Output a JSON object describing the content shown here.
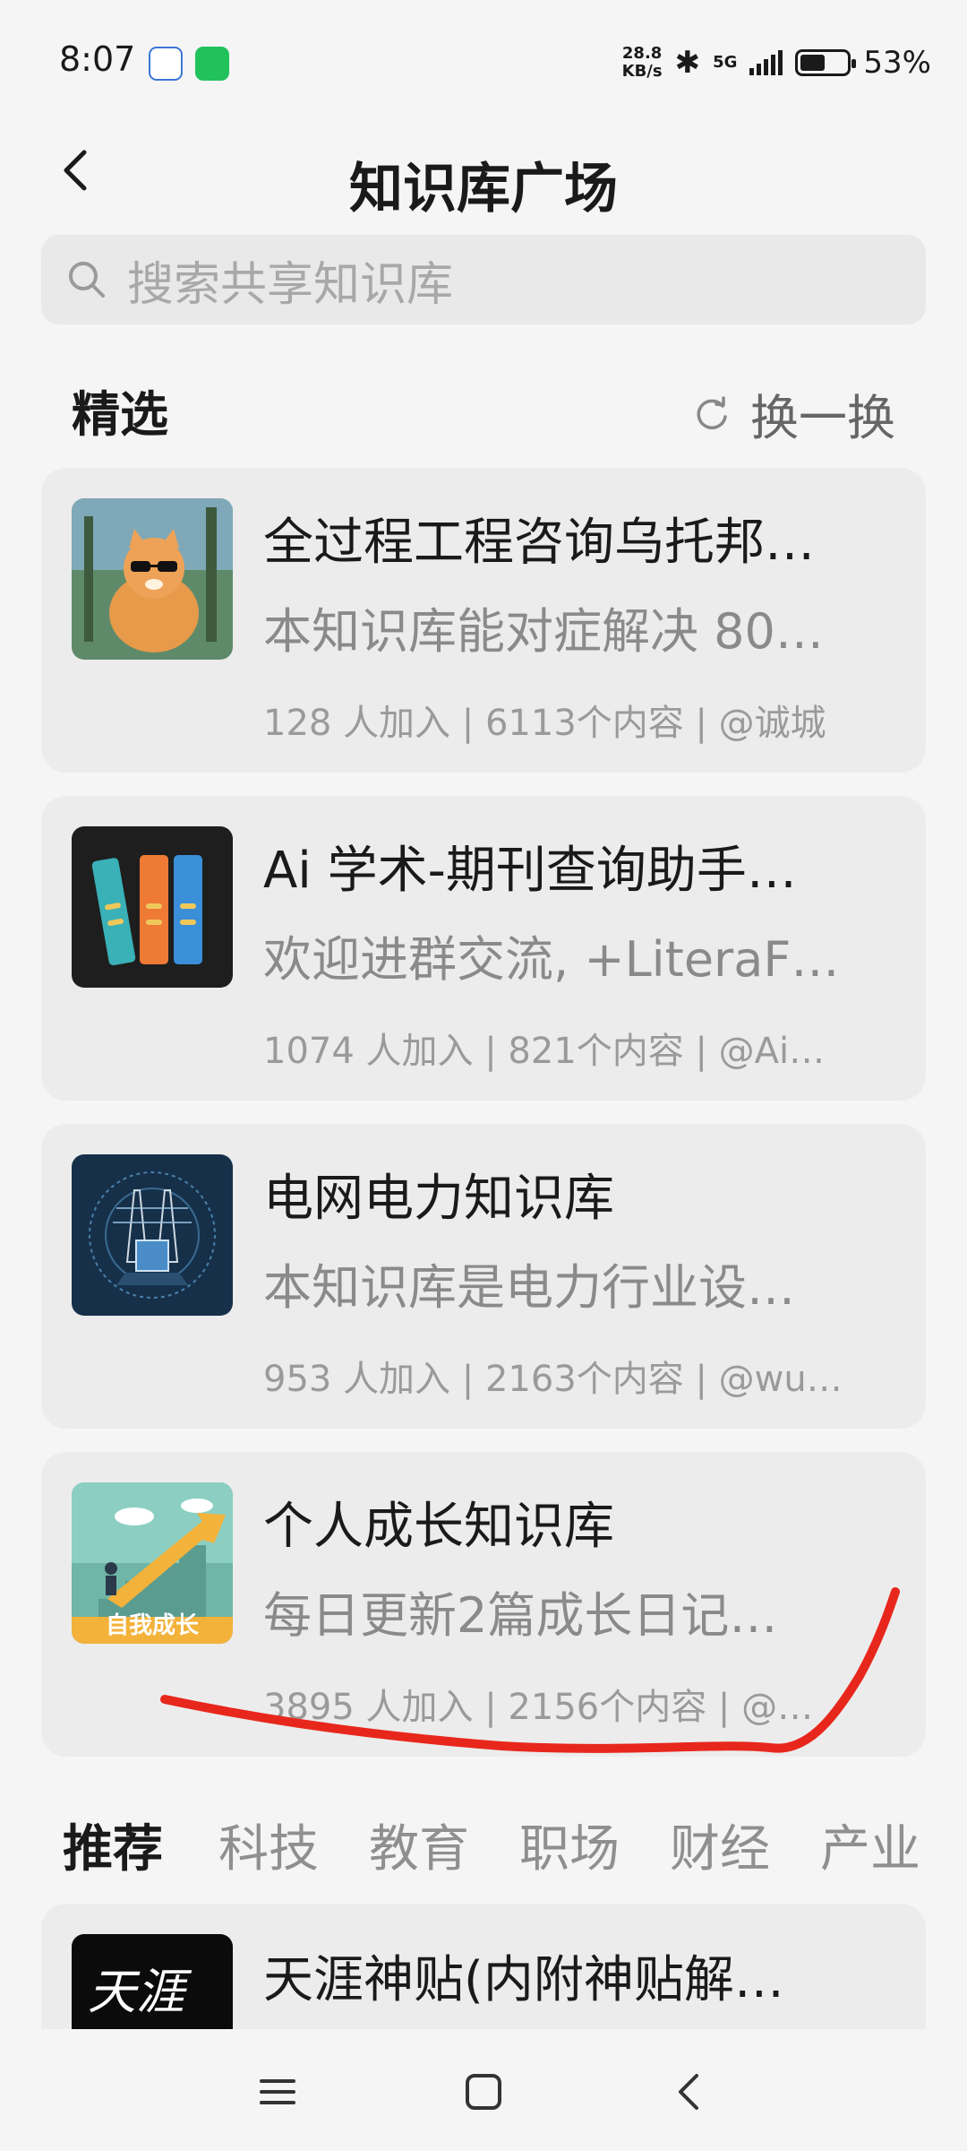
{
  "status_bar": {
    "time": "8:07",
    "net_speed_value": "28.8",
    "net_speed_unit": "KB/s",
    "network": "5G",
    "battery_percent": 53,
    "battery_text": "53%"
  },
  "header": {
    "title": "知识库广场"
  },
  "search": {
    "placeholder": "搜索共享知识库"
  },
  "featured": {
    "title": "精选",
    "refresh_label": "换一换",
    "items": [
      {
        "title": "全过程工程咨询乌托邦…",
        "desc": "本知识库能对症解决 80…",
        "meta": "128 人加入 | 6113个内容 | @诚城",
        "thumb_icon": "cat-with-sunglasses-image"
      },
      {
        "title": "Ai 学术-期刊查询助手…",
        "desc": "欢迎进群交流, +LiteraF…",
        "meta": "1074 人加入 | 821个内容 | @Ai…",
        "thumb_icon": "books-image"
      },
      {
        "title": "电网电力知识库",
        "desc": "本知识库是电力行业设…",
        "meta": "953 人加入 | 2163个内容 | @wu…",
        "thumb_icon": "power-grid-image"
      },
      {
        "title": "个人成长知识库",
        "desc": "每日更新2篇成长日记…",
        "meta": "3895 人加入 | 2156个内容 | @…",
        "thumb_icon": "growth-stairs-image",
        "thumb_caption": "自我成长"
      }
    ]
  },
  "tabs": [
    "推荐",
    "科技",
    "教育",
    "职场",
    "财经",
    "产业"
  ],
  "recommended": {
    "items": [
      {
        "title": "天涯神贴(内附神贴解…",
        "thumb_text": "天涯",
        "thumb_icon": "tianya-logo-image"
      }
    ]
  },
  "colors": {
    "background": "#f5f5f5",
    "card": "#ececec",
    "search_bg": "#e9e9e9",
    "annotation": "#e8271c"
  }
}
